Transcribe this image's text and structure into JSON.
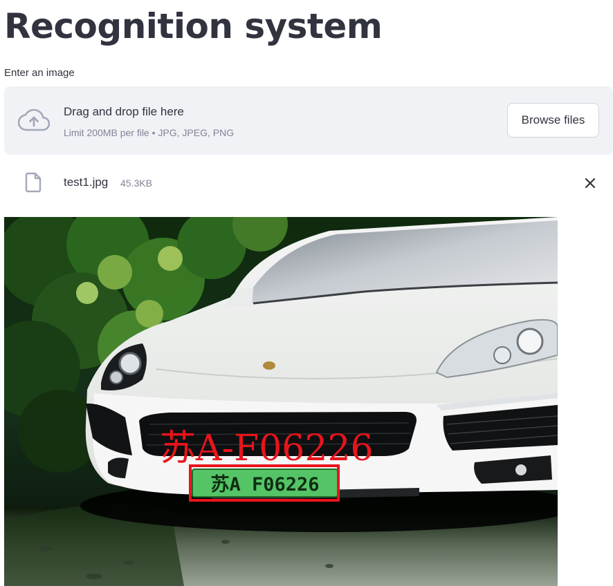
{
  "page": {
    "title": "Recognition system"
  },
  "uploader": {
    "label": "Enter an image",
    "drop_title": "Drag and drop file here",
    "limit_text": "Limit 200MB per file • JPG, JPEG, PNG",
    "browse_label": "Browse files",
    "upload_icon": "cloud-upload-icon"
  },
  "uploaded_file": {
    "name": "test1.jpg",
    "size": "45.3KB",
    "file_icon": "file-icon",
    "remove_icon": "close-icon"
  },
  "result": {
    "detected_plate_text": "苏A-F06226",
    "plate_text_on_car": "苏A F06226",
    "annotation_color": "#e8141c",
    "plate_color": "#54c466"
  },
  "colors": {
    "text": "#31333f",
    "muted": "#808495",
    "dropzone_bg": "#f0f2f6"
  }
}
